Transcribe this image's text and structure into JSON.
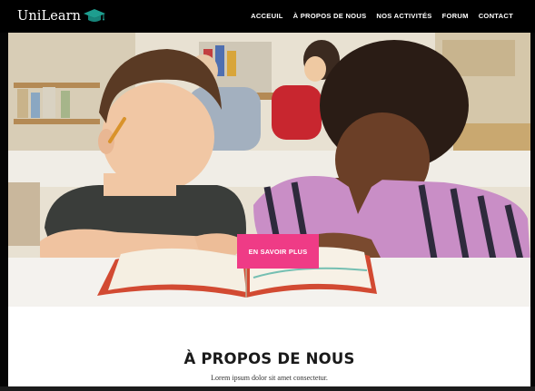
{
  "brand": {
    "name": "UniLearn",
    "accent": "#1e9e8f",
    "icon": "graduation-cap-icon"
  },
  "nav": {
    "items": [
      {
        "label": "ACCEUIL"
      },
      {
        "label": "À PROPOS DE NOUS"
      },
      {
        "label": "NOS ACTIVITÉS"
      },
      {
        "label": "FORUM"
      },
      {
        "label": "CONTACT"
      }
    ]
  },
  "hero": {
    "cta_label": "EN SAVOIR PLUS",
    "cta_color": "#ef3b86"
  },
  "about": {
    "title": "À PROPOS DE NOUS",
    "subtitle": "Lorem ipsum dolor sit amet consectetur."
  }
}
